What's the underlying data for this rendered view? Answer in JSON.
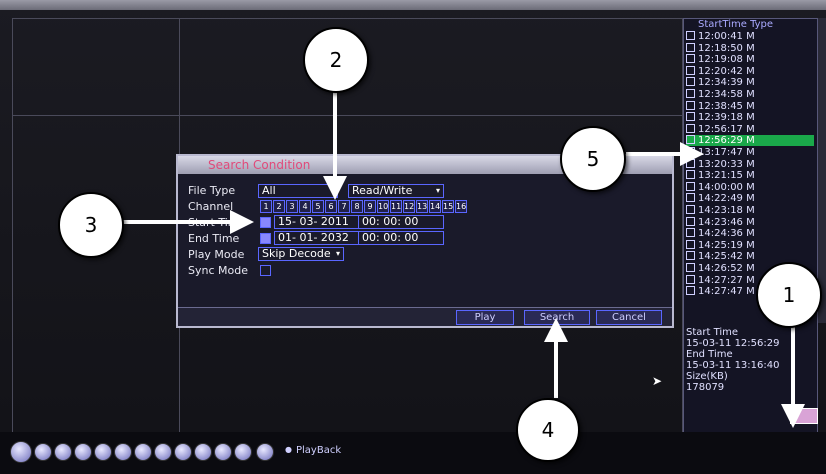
{
  "dialog": {
    "title": "Search Condition",
    "file_type_label": "File Type",
    "file_type_value": "All",
    "rw_value": "Read/Write",
    "channel_label": "Channel",
    "channels": [
      "1",
      "2",
      "3",
      "4",
      "5",
      "6",
      "7",
      "8",
      "9",
      "10",
      "11",
      "12",
      "13",
      "14",
      "15",
      "16"
    ],
    "start_time_label": "Start Time",
    "start_date": "15- 03- 2011",
    "start_time": "00: 00: 00",
    "end_time_label": "End Time",
    "end_date": "01- 01- 2032",
    "end_time": "00: 00: 00",
    "play_mode_label": "Play Mode",
    "play_mode_value": "Skip Decode",
    "sync_mode_label": "Sync Mode",
    "buttons": {
      "play": "Play",
      "search": "Search",
      "cancel": "Cancel"
    }
  },
  "file_list": {
    "header": "StartTime Type",
    "rows": [
      {
        "time": "12:00:41",
        "type": "M"
      },
      {
        "time": "12:18:50",
        "type": "M"
      },
      {
        "time": "12:19:08",
        "type": "M"
      },
      {
        "time": "12:20:42",
        "type": "M"
      },
      {
        "time": "12:34:39",
        "type": "M"
      },
      {
        "time": "12:34:58",
        "type": "M"
      },
      {
        "time": "12:38:45",
        "type": "M"
      },
      {
        "time": "12:39:18",
        "type": "M"
      },
      {
        "time": "12:56:17",
        "type": "M"
      },
      {
        "time": "12:56:29",
        "type": "M",
        "selected": true
      },
      {
        "time": "13:17:47",
        "type": "M"
      },
      {
        "time": "13:20:33",
        "type": "M"
      },
      {
        "time": "13:21:15",
        "type": "M"
      },
      {
        "time": "14:00:00",
        "type": "M"
      },
      {
        "time": "14:22:49",
        "type": "M"
      },
      {
        "time": "14:23:18",
        "type": "M"
      },
      {
        "time": "14:23:46",
        "type": "M"
      },
      {
        "time": "14:24:36",
        "type": "M"
      },
      {
        "time": "14:25:19",
        "type": "M"
      },
      {
        "time": "14:25:42",
        "type": "M"
      },
      {
        "time": "14:26:52",
        "type": "M"
      },
      {
        "time": "14:27:27",
        "type": "M"
      },
      {
        "time": "14:27:47",
        "type": "M"
      }
    ],
    "info": {
      "start_label": "Start Time",
      "start_value": "15-03-11 12:56:29",
      "end_label": "End Time",
      "end_value": "15-03-11 13:16:40",
      "size_label": "Size(KB)",
      "size_value": "178079"
    }
  },
  "playback": {
    "label": "PlayBack"
  },
  "callouts": [
    "1",
    "2",
    "3",
    "4",
    "5"
  ],
  "colors": {
    "accent": "#5a66ff",
    "selected": "#1aa84a",
    "title": "#e04a7a"
  }
}
